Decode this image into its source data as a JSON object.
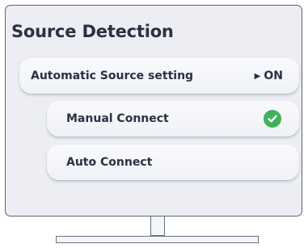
{
  "menu": {
    "title": "Source Detection",
    "automatic_source": {
      "label": "Automatic Source setting",
      "value": "ON"
    },
    "options": [
      {
        "label": "Manual Connect",
        "selected": true
      },
      {
        "label": "Auto Connect",
        "selected": false
      }
    ]
  },
  "icons": {
    "arrow": "play-arrow-icon",
    "check": "checkmark-circle-icon"
  },
  "colors": {
    "screen_bg": "#eceef3",
    "check_green": "#3fb15a",
    "text": "#2b3140"
  }
}
